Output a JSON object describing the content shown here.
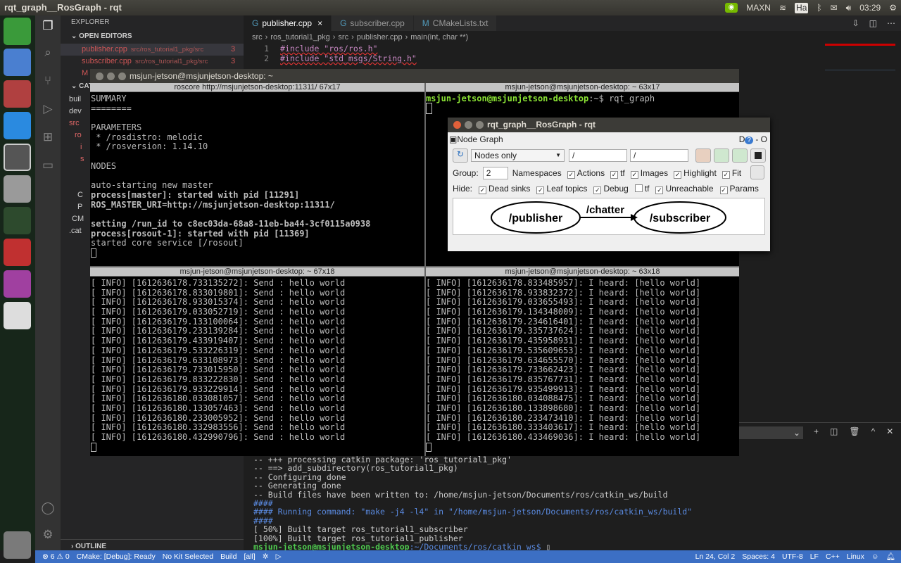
{
  "topbar": {
    "title": "rqt_graph__RosGraph - rqt",
    "nvidia_mode": "MAXN",
    "input_method": "Ha",
    "clock": "03:29"
  },
  "launcher": {
    "items": [
      "ubuntu-dash",
      "chromium",
      "file-manager",
      "vscode",
      "terminal",
      "camera",
      "web-camera",
      "app-red",
      "rqt",
      "drive"
    ],
    "trash": "trash"
  },
  "vscode": {
    "explorer_title": "EXPLORER",
    "open_editors_label": "OPEN EDITORS",
    "open_editors": [
      {
        "name": "publisher.cpp",
        "path": "src/ros_tutorial1_pkg/src",
        "badge": "3"
      },
      {
        "name": "subscriber.cpp",
        "path": "src/ros_tutorial1_pkg/src",
        "badge": "3"
      },
      {
        "name": "M",
        "path": "",
        "badge": ""
      }
    ],
    "workspace_label": "CATKIN",
    "tree": [
      "buil",
      "dev",
      "src",
      "ro",
      "i",
      "s",
      "",
      "",
      "C",
      "P",
      "CM",
      ".cat"
    ],
    "outline_label": "OUTLINE",
    "tabs": [
      "publisher.cpp",
      "subscriber.cpp",
      "CMakeLists.txt"
    ],
    "breadcrumb": [
      "src",
      "ros_tutorial1_pkg",
      "src",
      "publisher.cpp",
      "main(int, char **)"
    ],
    "code_lines": [
      {
        "n": "1",
        "text": "#include \"ros/ros.h\""
      },
      {
        "n": "2",
        "text": "#include \"std_msgs/String.h\""
      }
    ],
    "terminal_select": "h",
    "terminal_lines": [
      "-- +++ processing catkin package: 'ros_tutorial1_pkg'",
      "-- ==> add_subdirectory(ros_tutorial1_pkg)",
      "-- Configuring done",
      "-- Generating done",
      "-- Build files have been written to: /home/msjun-jetson/Documents/ros/catkin_ws/build",
      "####",
      "#### Running command: \"make -j4 -l4\" in \"/home/msjun-jetson/Documents/ros/catkin_ws/build\"",
      "####",
      "[ 50%] Built target ros_tutorial1_subscriber",
      "[100%] Built target ros_tutorial1_publisher"
    ],
    "prompt_user": "msjun-jetson@msjunjetson-desktop",
    "prompt_path": ":~/Documents/ros/catkin_ws$",
    "status": {
      "errors": "6",
      "warnings": "0",
      "cmake": "CMake: [Debug]: Ready",
      "kit": "No Kit Selected",
      "build": "Build",
      "target": "[all]",
      "position": "Ln 24, Col 2",
      "spaces": "Spaces: 4",
      "encoding": "UTF-8",
      "eol": "LF",
      "language": "C++",
      "os": "Linux"
    }
  },
  "terminator": {
    "title": "msjun-jetson@msjunjetson-desktop: ~",
    "panes": [
      {
        "header": "roscore http://msjunjetson-desktop:11311/ 67x17",
        "lines": [
          "SUMMARY",
          "========",
          "",
          "PARAMETERS",
          " * /rosdistro: melodic",
          " * /rosversion: 1.14.10",
          "",
          "NODES",
          "",
          "auto-starting new master",
          "process[master]: started with pid [11291]",
          "ROS_MASTER_URI=http://msjunjetson-desktop:11311/",
          "",
          "setting /run_id to c8ec03da-68a8-11eb-ba44-3cf0115a0938",
          "process[rosout-1]: started with pid [11369]",
          "started core service [/rosout]"
        ]
      },
      {
        "header": "msjun-jetson@msjunjetson-desktop: ~ 63x17",
        "prompt_user": "msjun-jetson@msjunjetson-desktop",
        "prompt_rest": ":~$ rqt_graph"
      },
      {
        "header": "msjun-jetson@msjunjetson-desktop: ~ 67x18",
        "lines": [
          "[ INFO] [1612636178.733135272]: Send : hello world",
          "[ INFO] [1612636178.833019801]: Send : hello world",
          "[ INFO] [1612636178.933015374]: Send : hello world",
          "[ INFO] [1612636179.033052719]: Send : hello world",
          "[ INFO] [1612636179.133100064]: Send : hello world",
          "[ INFO] [1612636179.233139284]: Send : hello world",
          "[ INFO] [1612636179.433919407]: Send : hello world",
          "[ INFO] [1612636179.533226319]: Send : hello world",
          "[ INFO] [1612636179.633108973]: Send : hello world",
          "[ INFO] [1612636179.733015950]: Send : hello world",
          "[ INFO] [1612636179.833222830]: Send : hello world",
          "[ INFO] [1612636179.933229914]: Send : hello world",
          "[ INFO] [1612636180.033081057]: Send : hello world",
          "[ INFO] [1612636180.133057463]: Send : hello world",
          "[ INFO] [1612636180.233005952]: Send : hello world",
          "[ INFO] [1612636180.332983556]: Send : hello world",
          "[ INFO] [1612636180.432990796]: Send : hello world"
        ]
      },
      {
        "header": "msjun-jetson@msjunjetson-desktop: ~ 63x18",
        "lines": [
          "[ INFO] [1612636178.833485957]: I heard: [hello world]",
          "[ INFO] [1612636178.933832372]: I heard: [hello world]",
          "[ INFO] [1612636179.033655493]: I heard: [hello world]",
          "[ INFO] [1612636179.134348009]: I heard: [hello world]",
          "[ INFO] [1612636179.234616401]: I heard: [hello world]",
          "[ INFO] [1612636179.335737624]: I heard: [hello world]",
          "[ INFO] [1612636179.435958931]: I heard: [hello world]",
          "[ INFO] [1612636179.535609653]: I heard: [hello world]",
          "[ INFO] [1612636179.634655570]: I heard: [hello world]",
          "[ INFO] [1612636179.733662423]: I heard: [hello world]",
          "[ INFO] [1612636179.835767731]: I heard: [hello world]",
          "[ INFO] [1612636179.935499913]: I heard: [hello world]",
          "[ INFO] [1612636180.034088475]: I heard: [hello world]",
          "[ INFO] [1612636180.133898680]: I heard: [hello world]",
          "[ INFO] [1612636180.233473410]: I heard: [hello world]",
          "[ INFO] [1612636180.333403617]: I heard: [hello world]",
          "[ INFO] [1612636180.433469036]: I heard: [hello world]"
        ]
      }
    ]
  },
  "rqt": {
    "title": "rqt_graph__RosGraph - rqt",
    "plugin": "Node Graph",
    "plugin_controls": "D",
    "plugin_close": "- O",
    "mode": "Nodes only",
    "filter1": "/",
    "filter2": "/",
    "group_label": "Group:",
    "group_value": "2",
    "options": [
      {
        "label": "Namespaces",
        "checked": true
      },
      {
        "label": "Actions",
        "checked": true
      },
      {
        "label": "tf",
        "checked": true
      },
      {
        "label": "Images",
        "checked": true
      },
      {
        "label": "Highlight",
        "checked": true
      },
      {
        "label": "Fit",
        "checked": true
      }
    ],
    "hide_label": "Hide:",
    "hide": [
      {
        "label": "Dead sinks",
        "checked": true
      },
      {
        "label": "Leaf topics",
        "checked": true
      },
      {
        "label": "Debug",
        "checked": true
      },
      {
        "label": "tf",
        "checked": false
      },
      {
        "label": "Unreachable",
        "checked": true
      },
      {
        "label": "Params",
        "checked": true
      }
    ],
    "graph": {
      "source": "/publisher",
      "topic": "/chatter",
      "target": "/subscriber"
    }
  }
}
